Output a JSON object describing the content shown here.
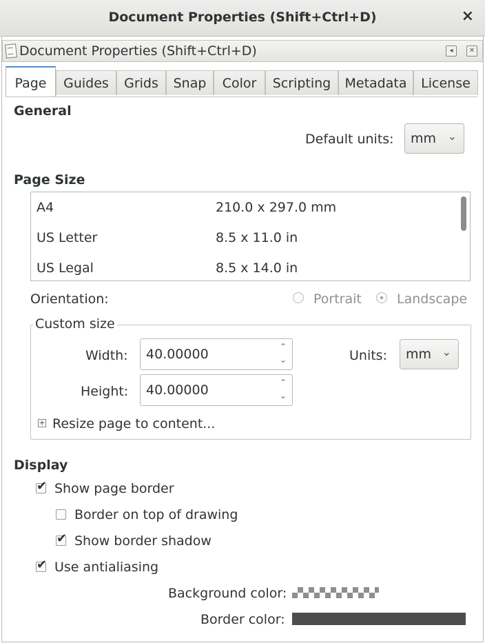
{
  "window": {
    "title": "Document Properties (Shift+Ctrl+D)",
    "close_glyph": "×"
  },
  "dock": {
    "label": "Document Properties (Shift+Ctrl+D)"
  },
  "tabs": [
    {
      "label": "Page",
      "active": true
    },
    {
      "label": "Guides"
    },
    {
      "label": "Grids"
    },
    {
      "label": "Snap"
    },
    {
      "label": "Color"
    },
    {
      "label": "Scripting"
    },
    {
      "label": "Metadata"
    },
    {
      "label": "License"
    }
  ],
  "general": {
    "title": "General",
    "default_units_label": "Default units:",
    "default_units_value": "mm"
  },
  "page_size": {
    "title": "Page Size",
    "rows": [
      {
        "name": "A4",
        "dims": "210.0 x 297.0 mm"
      },
      {
        "name": "US Letter",
        "dims": "8.5 x 11.0 in"
      },
      {
        "name": "US Legal",
        "dims": "8.5 x 14.0 in"
      }
    ],
    "orientation_label": "Orientation:",
    "portrait_label": "Portrait",
    "landscape_label": "Landscape"
  },
  "custom_size": {
    "title": "Custom size",
    "width_label": "Width:",
    "width_value": "40.00000",
    "height_label": "Height:",
    "height_value": "40.00000",
    "units_label": "Units:",
    "units_value": "mm",
    "resize_label": "Resize page to content..."
  },
  "display": {
    "title": "Display",
    "show_page_border": {
      "label": "Show page border",
      "checked": true
    },
    "border_on_top": {
      "label": "Border on top of drawing",
      "checked": false
    },
    "show_border_shadow": {
      "label": "Show border shadow",
      "checked": true
    },
    "use_antialiasing": {
      "label": "Use antialiasing",
      "checked": true
    },
    "background_color_label": "Background color:",
    "border_color_label": "Border color:",
    "border_color": "#4d4d4d"
  },
  "icons": {
    "chevron": "⌄",
    "check": "✔",
    "up": "⌃",
    "down": "⌄",
    "plus": "+"
  }
}
